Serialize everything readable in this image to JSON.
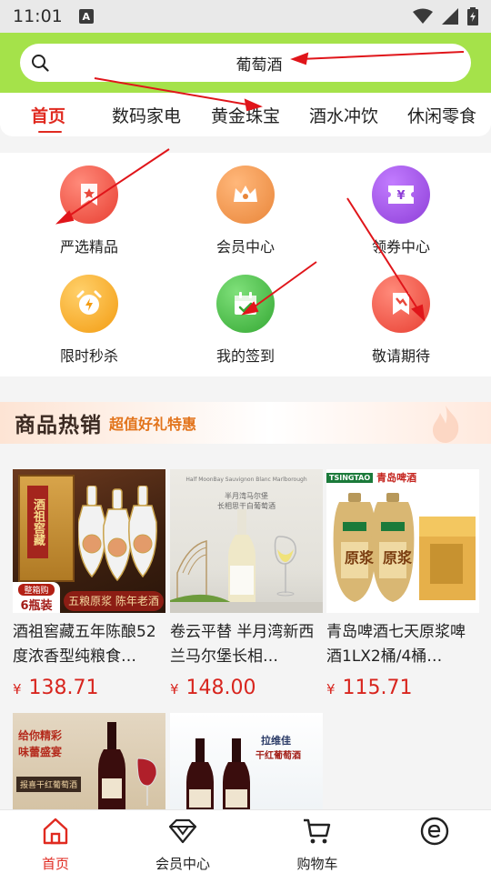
{
  "status": {
    "time": "11:01",
    "notif": "A"
  },
  "search": {
    "query": "葡萄酒"
  },
  "tabs": [
    {
      "label": "首页"
    },
    {
      "label": "数码家电"
    },
    {
      "label": "黄金珠宝"
    },
    {
      "label": "酒水冲饮"
    },
    {
      "label": "休闲零食"
    }
  ],
  "grid": [
    {
      "label": "严选精品",
      "icon": "bookmark-star-icon",
      "color": "#ee4b3e"
    },
    {
      "label": "会员中心",
      "icon": "crown-icon",
      "color": "#ec8f3d"
    },
    {
      "label": "领券中心",
      "icon": "coupon-icon",
      "color": "#9b4fe0"
    },
    {
      "label": "限时秒杀",
      "icon": "alarm-clock-icon",
      "color": "#f7a51d"
    },
    {
      "label": "我的签到",
      "icon": "calendar-check-icon",
      "color": "#3fb43a"
    },
    {
      "label": "敬请期待",
      "icon": "bookmark-flag-icon",
      "color": "#ee4b3e"
    }
  ],
  "banner": {
    "title": "商品热销",
    "subtitle": "超值好礼特惠"
  },
  "products": [
    {
      "name": "酒祖窖藏五年陈酿52度浓香型纯粮食…",
      "currency": "¥",
      "price": "138.71",
      "image_text": {
        "brand": "酒祖窖藏",
        "badge_top": "整箱购",
        "badge_count": "6",
        "badge_unit": "瓶装",
        "tagline": "五粮原浆 陈年老酒"
      }
    },
    {
      "name": "卷云平替 半月湾新西兰马尔堡长相…",
      "currency": "¥",
      "price": "148.00",
      "image_text": {
        "line1": "Half MoonBay Sauvignon Blanc Marlborough",
        "line2": "半月湾马尔堡",
        "line3": "长相思干白葡萄酒"
      }
    },
    {
      "name": "青岛啤酒七天原浆啤酒1LX2桶/4桶…",
      "currency": "¥",
      "price": "115.71",
      "image_text": {
        "brand_en": "TSINGTAO",
        "brand_cn": "青岛啤酒",
        "label": "原浆"
      }
    },
    {
      "name": "",
      "image_text": {
        "line1": "给你精彩",
        "line2": "味蕾盛宴",
        "line3": "报喜干红葡萄酒"
      }
    },
    {
      "name": "",
      "image_text": {
        "line1": "拉维佳",
        "line2": "干红葡萄酒"
      }
    }
  ],
  "bottom_nav": [
    {
      "label": "首页",
      "icon": "home-icon",
      "active": true
    },
    {
      "label": "会员中心",
      "icon": "diamond-icon",
      "active": false
    },
    {
      "label": "购物车",
      "icon": "cart-icon",
      "active": false
    },
    {
      "label": "",
      "icon": "e-logo-icon",
      "active": false
    }
  ],
  "colors": {
    "accent": "#e02a20",
    "search_bg": "#a5e24a",
    "price": "#d8251e",
    "annotation": "#e0151a"
  }
}
